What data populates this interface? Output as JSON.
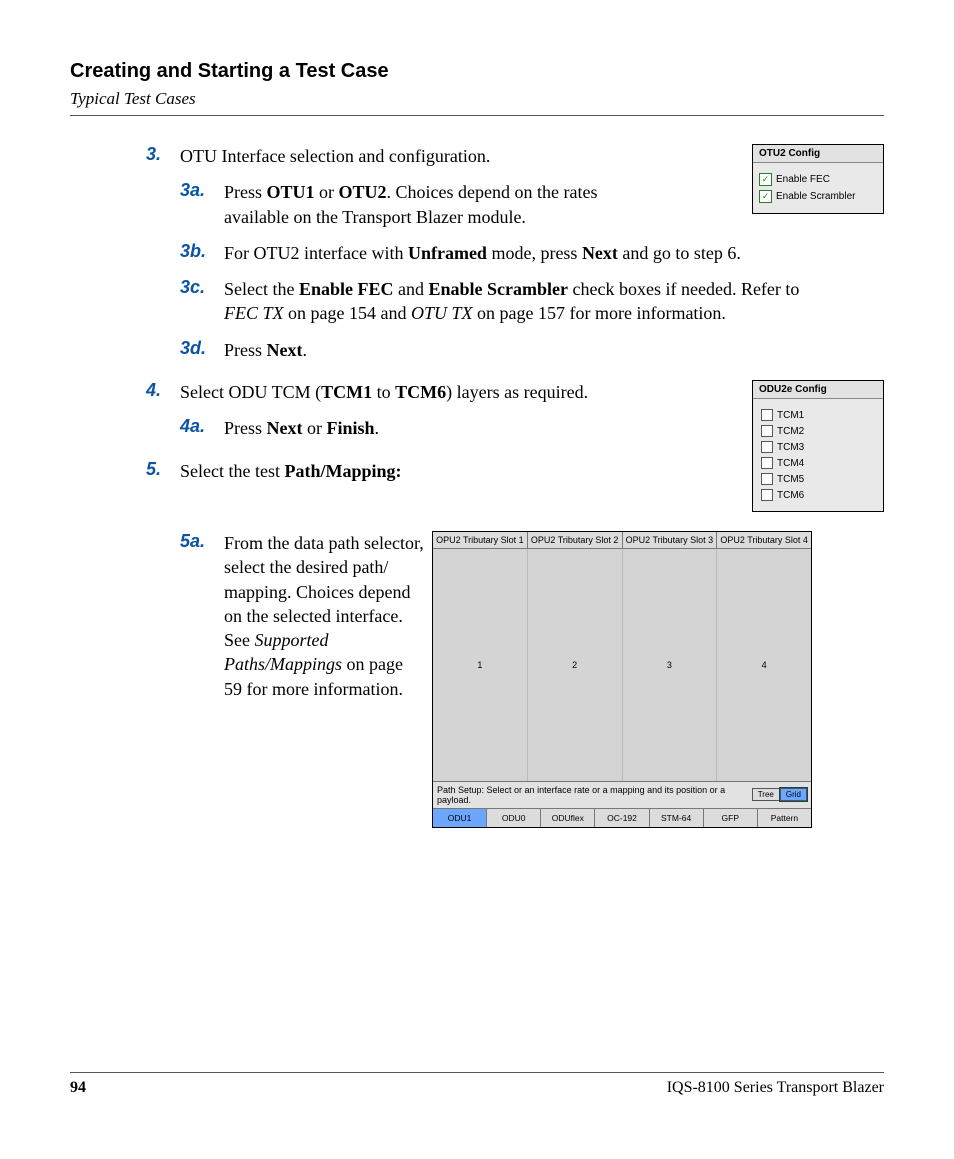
{
  "header": {
    "title": "Creating and Starting a Test Case",
    "subtitle": "Typical Test Cases"
  },
  "steps": {
    "s3": {
      "num": "3.",
      "text": "OTU Interface selection and configuration.",
      "a": {
        "num": "3a.",
        "p1": "Press ",
        "b1": "OTU1",
        "p2": " or ",
        "b2": "OTU2",
        "p3": ". Choices depend on the rates available on the Transport Blazer module."
      },
      "b": {
        "num": "3b.",
        "p1": "For OTU2 interface with ",
        "b1": "Unframed",
        "p2": " mode, press ",
        "b2": "Next",
        "p3": " and go to step 6."
      },
      "c": {
        "num": "3c.",
        "p1": "Select the ",
        "b1": "Enable FEC",
        "p2": " and ",
        "b2": "Enable Scrambler",
        "p3": " check boxes if needed. Refer to ",
        "i1": "FEC TX",
        "p4": " on page 154 and ",
        "i2": "OTU TX",
        "p5": " on page 157 for more information."
      },
      "d": {
        "num": "3d.",
        "p1": "Press ",
        "b1": "Next",
        "p2": "."
      }
    },
    "s4": {
      "num": "4.",
      "p1": "Select ODU TCM (",
      "b1": "TCM1",
      "p2": " to ",
      "b2": "TCM6",
      "p3": ") layers as required.",
      "a": {
        "num": "4a.",
        "p1": "Press ",
        "b1": "Next",
        "p2": " or ",
        "b2": "Finish",
        "p3": "."
      }
    },
    "s5": {
      "num": "5.",
      "p1": "Select the test ",
      "b1": "Path/Mapping:",
      "a": {
        "num": "5a.",
        "p1": "From the data path selector, select the desired path/ mapping. Choices depend on the selected interface. See ",
        "i1": "Supported Paths/Mappings",
        "p2": " on page 59 for more information."
      }
    }
  },
  "panels": {
    "otu2": {
      "title": "OTU2 Config",
      "cb1": "Enable FEC",
      "cb2": "Enable Scrambler",
      "check": "✓"
    },
    "odu2e": {
      "title": "ODU2e Config",
      "items": [
        "TCM1",
        "TCM2",
        "TCM3",
        "TCM4",
        "TCM5",
        "TCM6"
      ]
    },
    "grid": {
      "headers": [
        "OPU2 Tributary Slot 1",
        "OPU2 Tributary Slot 2",
        "OPU2 Tributary Slot 3",
        "OPU2 Tributary Slot 4"
      ],
      "cells": [
        "1",
        "2",
        "3",
        "4"
      ],
      "status": "Path Setup: Select  or an interface rate or a mapping and its position or a payload.",
      "view_tree": "Tree",
      "view_grid": "Grid",
      "footer": [
        "ODU1",
        "ODU0",
        "ODUflex",
        "OC-192",
        "STM-64",
        "GFP",
        "Pattern"
      ]
    }
  },
  "footer": {
    "page": "94",
    "product": "IQS-8100 Series Transport Blazer"
  }
}
